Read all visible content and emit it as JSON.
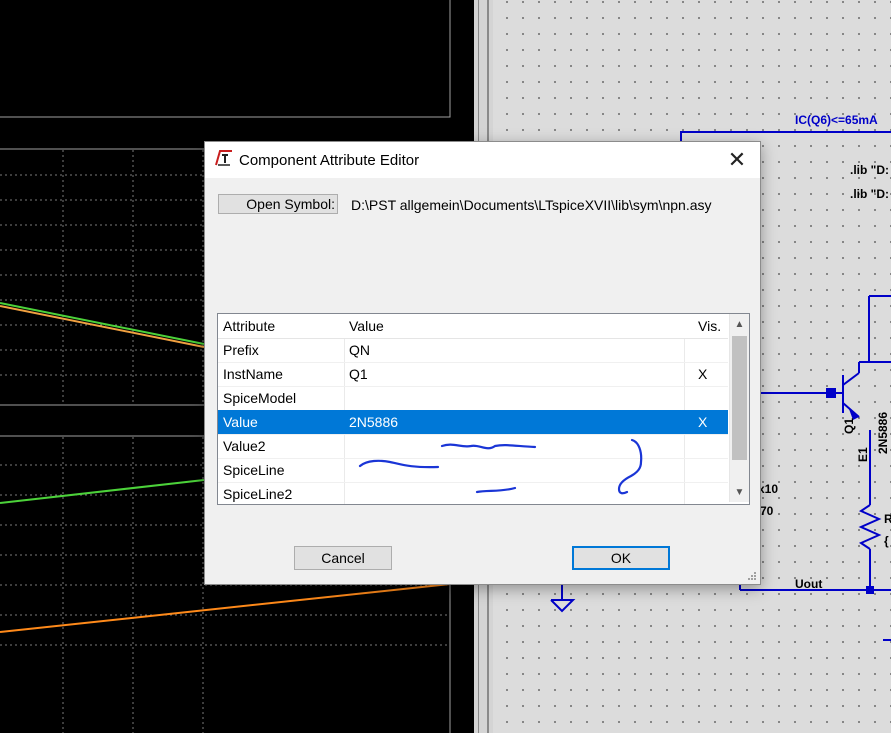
{
  "dialog": {
    "title": "Component Attribute Editor",
    "close_label": "✕",
    "open_symbol_label": "Open Symbol:",
    "symbol_path": "D:\\PST allgemein\\Documents\\LTspiceXVII\\lib\\sym\\npn.asy",
    "cancel_label": "Cancel",
    "ok_label": "OK",
    "icons": {
      "title": "ltspice-logo-icon",
      "close": "close-icon",
      "scroll_up": "chevron-up-icon",
      "scroll_down": "chevron-down-icon",
      "grip": "resize-grip-icon"
    }
  },
  "table": {
    "columns": [
      "Attribute",
      "Value",
      "Vis."
    ],
    "rows": [
      {
        "attribute": "Prefix",
        "value": "QN",
        "vis": ""
      },
      {
        "attribute": "InstName",
        "value": "Q1",
        "vis": "X"
      },
      {
        "attribute": "SpiceModel",
        "value": "",
        "vis": ""
      },
      {
        "attribute": "Value",
        "value": "2N5886",
        "vis": "X",
        "selected": true
      },
      {
        "attribute": "Value2",
        "value": "",
        "vis": ""
      },
      {
        "attribute": "SpiceLine",
        "value": "",
        "vis": ""
      },
      {
        "attribute": "SpiceLine2",
        "value": "",
        "vis": ""
      }
    ],
    "selection_color": "#0078d7"
  },
  "schematic": {
    "labels": {
      "measure": "IC(Q6)<=65mA",
      "lib1": ".lib \"D:",
      "lib2": ".lib \"D:",
      "q1": "Q1",
      "part": "2N5886",
      "e1": "E1",
      "r": "R",
      "r_brace": "{",
      "uout": "Uout",
      "x10": "x10",
      "n70": "70"
    },
    "wire_color": "#0000c8"
  },
  "waveform": {
    "trace_colors": [
      "#4cd23a",
      "#f0a040",
      "#ff8a1a"
    ]
  }
}
